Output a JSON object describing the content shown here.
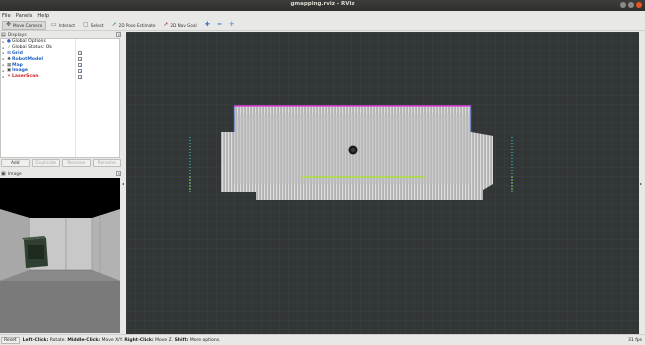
{
  "window": {
    "title": "gmapping.rviz - RViz"
  },
  "menu": [
    "File",
    "Panels",
    "Help"
  ],
  "toolbar": {
    "tools": [
      {
        "label": "Move Camera",
        "icon": "move-camera-icon",
        "glyph": "✥",
        "active": true
      },
      {
        "label": "Interact",
        "icon": "interact-icon",
        "glyph": "▭",
        "active": false
      },
      {
        "label": "Select",
        "icon": "select-icon",
        "glyph": "▢",
        "active": false
      },
      {
        "label": "2D Pose Estimate",
        "icon": "pose-estimate-icon",
        "glyph": "➚",
        "active": false
      },
      {
        "label": "2D Nav Goal",
        "icon": "nav-goal-icon",
        "glyph": "➚",
        "active": false
      }
    ]
  },
  "displays": {
    "title": "Displays",
    "items": [
      {
        "label": "Global Options",
        "icon": "global-options-icon",
        "glyph": "●",
        "style": "",
        "checkbox": false
      },
      {
        "label": "Global Status: Ok",
        "icon": "status-ok-icon",
        "glyph": "✓",
        "style": "",
        "checkbox": false
      },
      {
        "label": "Grid",
        "icon": "grid-icon",
        "glyph": "⊞",
        "style": "blue",
        "checkbox": true
      },
      {
        "label": "RobotModel",
        "icon": "robot-model-icon",
        "glyph": "♣",
        "style": "blue",
        "checkbox": true
      },
      {
        "label": "Map",
        "icon": "map-icon",
        "glyph": "▦",
        "style": "blue",
        "checkbox": true
      },
      {
        "label": "Image",
        "icon": "image-icon",
        "glyph": "▣",
        "style": "blue",
        "checkbox": true
      },
      {
        "label": "LaserScan",
        "icon": "laser-scan-icon",
        "glyph": "✶",
        "style": "red",
        "checkbox": true
      }
    ],
    "buttons": {
      "add": "Add",
      "duplicate": "Duplicate",
      "remove": "Remove",
      "rename": "Rename"
    }
  },
  "image_panel": {
    "title": "Image"
  },
  "status": {
    "reset": "Reset",
    "hint_parts": [
      {
        "bold": true,
        "text": "Left-Click:"
      },
      {
        "bold": false,
        "text": " Rotate. "
      },
      {
        "bold": true,
        "text": "Middle-Click:"
      },
      {
        "bold": false,
        "text": " Move X/Y. "
      },
      {
        "bold": true,
        "text": "Right-Click:"
      },
      {
        "bold": false,
        "text": " Move Z. "
      },
      {
        "bold": true,
        "text": "Shift:"
      },
      {
        "bold": false,
        "text": " More options."
      }
    ],
    "fps": "31 fps"
  },
  "colors": {
    "accent": "#e95420",
    "grid_bg": "#303030",
    "grid_line": "#3d4a48",
    "map_free": "#c8c8c8",
    "scan": "#a9e03a",
    "scan_top": "#c040c0"
  }
}
